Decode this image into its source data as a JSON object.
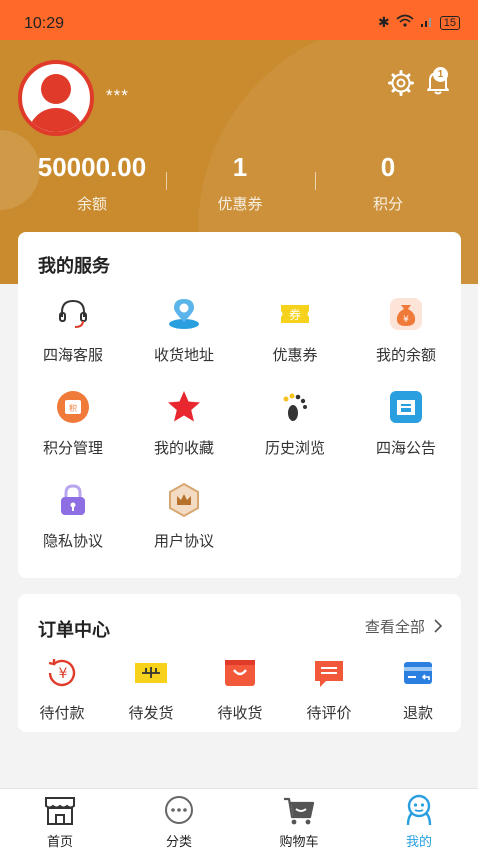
{
  "status_bar": {
    "time": "10:29",
    "battery": "15"
  },
  "profile": {
    "username": "***",
    "notification_count": "1"
  },
  "stats": [
    {
      "value": "50000.00",
      "label": "余额"
    },
    {
      "value": "1",
      "label": "优惠券"
    },
    {
      "value": "0",
      "label": "积分"
    }
  ],
  "services": {
    "title": "我的服务",
    "items": [
      {
        "label": "四海客服",
        "icon": "headset-icon"
      },
      {
        "label": "收货地址",
        "icon": "location-icon"
      },
      {
        "label": "优惠券",
        "icon": "coupon-icon"
      },
      {
        "label": "我的余额",
        "icon": "money-bag-icon"
      },
      {
        "label": "积分管理",
        "icon": "points-icon"
      },
      {
        "label": "我的收藏",
        "icon": "star-icon"
      },
      {
        "label": "历史浏览",
        "icon": "footprint-icon"
      },
      {
        "label": "四海公告",
        "icon": "notice-icon"
      },
      {
        "label": "隐私协议",
        "icon": "lock-icon"
      },
      {
        "label": "用户协议",
        "icon": "crown-icon"
      }
    ]
  },
  "orders": {
    "title": "订单中心",
    "view_all": "查看全部",
    "items": [
      {
        "label": "待付款",
        "icon": "yuan-icon"
      },
      {
        "label": "待发货",
        "icon": "box-icon"
      },
      {
        "label": "待收货",
        "icon": "bag-icon"
      },
      {
        "label": "待评价",
        "icon": "comment-icon"
      },
      {
        "label": "退款",
        "icon": "card-icon"
      }
    ]
  },
  "tabbar": [
    {
      "label": "首页",
      "icon": "shop-icon"
    },
    {
      "label": "分类",
      "icon": "dots-icon"
    },
    {
      "label": "购物车",
      "icon": "cart-icon"
    },
    {
      "label": "我的",
      "icon": "user-icon",
      "active": true
    }
  ],
  "colors": {
    "header": "#c98b2e",
    "status_bar": "#ff6a2b",
    "accent": "#2a9fe0",
    "red": "#e03b2a"
  }
}
